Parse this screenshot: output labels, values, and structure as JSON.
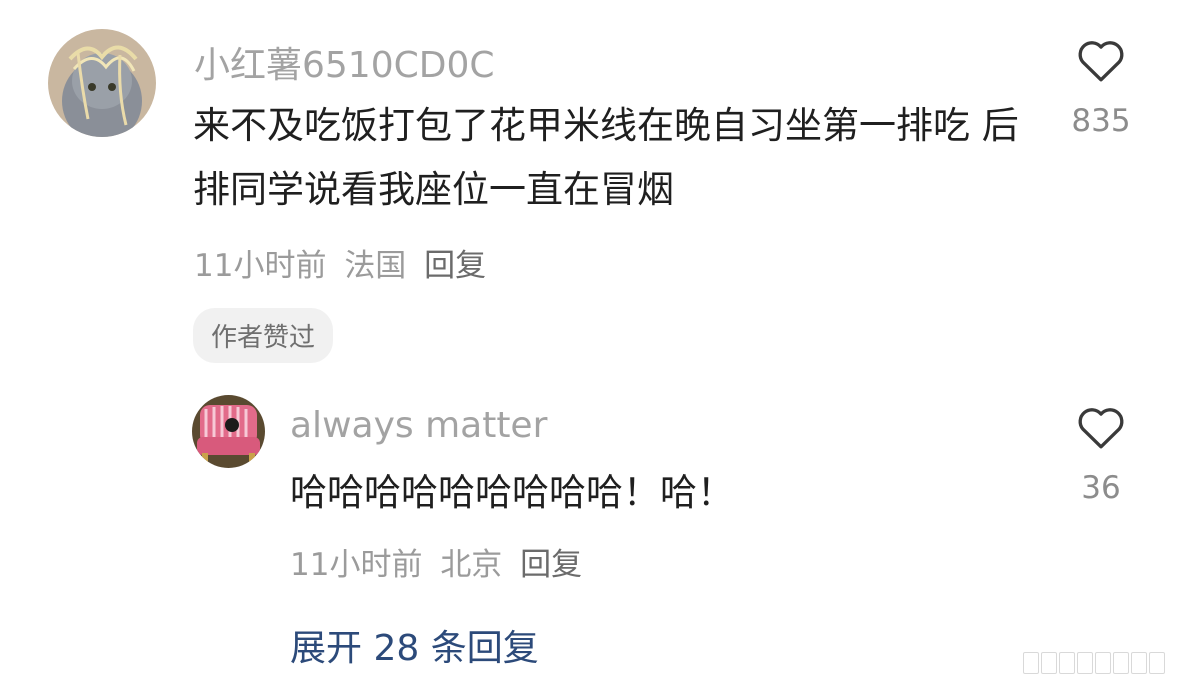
{
  "comment": {
    "username": "小红薯6510CD0C",
    "text": "来不及吃饭打包了花甲米线在晚自习坐第一排吃 后排同学说看我座位一直在冒烟",
    "time": "11小时前",
    "location": "法国",
    "reply_label": "回复",
    "likes": "835",
    "badge": "作者赞过",
    "avatar_icon": "cat-with-noodles-avatar"
  },
  "reply": {
    "username": "always matter",
    "text": "哈哈哈哈哈哈哈哈哈！哈！",
    "time": "11小时前",
    "location": "北京",
    "reply_label": "回复",
    "likes": "36",
    "avatar_icon": "pink-armchair-avatar"
  },
  "expand_label": "展开 28 条回复",
  "colors": {
    "link": "#2c4a7a",
    "muted": "#9b9b9b",
    "badge_bg": "#f1f1f1"
  }
}
